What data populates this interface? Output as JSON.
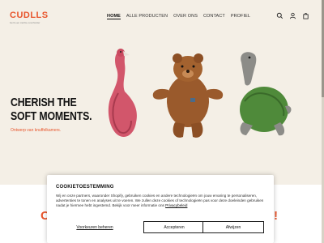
{
  "brand": {
    "name": "CUDLLS",
    "tagline": "bezit een zachte onschulder",
    "accent_color": "#e8552c"
  },
  "nav": {
    "items": [
      {
        "label": "HOME",
        "active": true
      },
      {
        "label": "ALLE PRODUCTEN",
        "active": false
      },
      {
        "label": "OVER ONS",
        "active": false
      },
      {
        "label": "CONTACT",
        "active": false
      },
      {
        "label": "PROFIEL",
        "active": false
      }
    ]
  },
  "header_icons": [
    "search-icon",
    "account-icon",
    "cart-icon"
  ],
  "hero": {
    "title_line1": "CHERISH THE",
    "title_line2": "SOFT MOMENTS.",
    "subtitle": "Ontwerp van knuffelkamers.",
    "toys": [
      "flamingo-toy",
      "bear-toy",
      "turtle-toy"
    ]
  },
  "below_banner": {
    "left_text": "O",
    "right_text": "!"
  },
  "cookie_banner": {
    "title": "COOKIETOESTEMMING",
    "body": "Wij en onze partners, waaronder Shopify, gebruiken cookies en andere technologieën om jouw ervaring te personaliseren, advertenties te tonen en analyses uit te voeren. We zullen deze cookies of technologieën pas voor deze doeleinden gebruiken nadat je hiermee hebt ingestemd. Bekijk voor meer informatie ons",
    "policy_link": "Privacybeleid",
    "preferences_label": "Voorkeuren beheren",
    "accept_label": "Accepteren",
    "reject_label": "Afwijzen"
  }
}
